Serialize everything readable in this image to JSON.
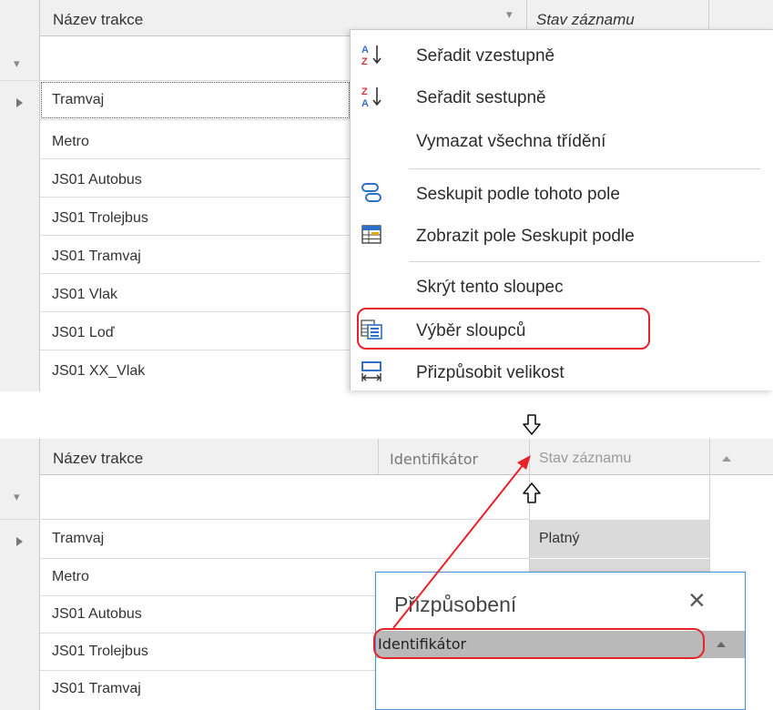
{
  "top_grid": {
    "col_name_header": "Název trakce",
    "col_status_header": "Stav záznamu",
    "rows": [
      "Tramvaj",
      "Metro",
      "JS01 Autobus",
      "JS01 Trolejbus",
      "JS01 Tramvaj",
      "JS01 Vlak",
      "JS01 Loď",
      "JS01 XX_Vlak"
    ]
  },
  "context_menu": {
    "items": [
      {
        "label": "Seřadit vzestupně",
        "icon": "sort-ascending-icon"
      },
      {
        "label": "Seřadit sestupně",
        "icon": "sort-descending-icon"
      },
      {
        "label": "Vymazat všechna třídění",
        "icon": ""
      },
      {
        "label": "Seskupit podle tohoto pole",
        "icon": "group-by-field-icon"
      },
      {
        "label": "Zobrazit pole Seskupit podle",
        "icon": "show-group-box-icon"
      },
      {
        "label": "Skrýt tento sloupec",
        "icon": ""
      },
      {
        "label": "Výběr sloupců",
        "icon": "column-chooser-icon"
      },
      {
        "label": "Přizpůsobit velikost",
        "icon": "best-fit-icon"
      }
    ]
  },
  "bottom_grid": {
    "col_name_header": "Název trakce",
    "col_identifier_header": "Identifikátor",
    "col_status_header": "Stav záznamu",
    "rows": [
      "Tramvaj",
      "Metro",
      "JS01 Autobus",
      "JS01 Trolejbus",
      "JS01 Tramvaj"
    ],
    "status_first_row": "Platný"
  },
  "customization_dialog": {
    "title": "Přizpůsobení",
    "close_glyph": "×",
    "items": [
      "Identifikátor"
    ]
  },
  "colors": {
    "highlight_red": "#e8212b",
    "dialog_border": "#4a90d9"
  }
}
